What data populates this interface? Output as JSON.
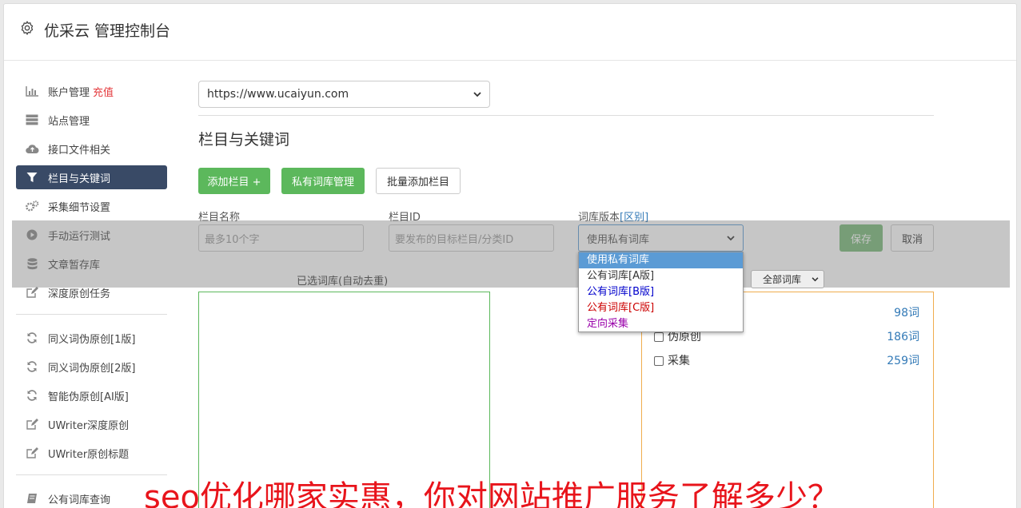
{
  "header": {
    "title": "优采云 管理控制台"
  },
  "sidebar": {
    "items": [
      {
        "label": "账户管理",
        "badge": "充值",
        "icon": "bar-chart-icon"
      },
      {
        "label": "站点管理",
        "icon": "server-icon"
      },
      {
        "label": "接口文件相关",
        "icon": "cloud-upload-icon"
      },
      {
        "label": "栏目与关键词",
        "icon": "filter-icon",
        "active": true
      },
      {
        "label": "采集细节设置",
        "icon": "gears-icon"
      },
      {
        "label": "手动运行测试",
        "icon": "play-circle-icon"
      },
      {
        "label": "文章暂存库",
        "icon": "database-icon"
      },
      {
        "label": "深度原创任务",
        "icon": "edit-icon"
      },
      {
        "label": "同义词伪原创[1版]",
        "icon": "refresh-icon"
      },
      {
        "label": "同义词伪原创[2版]",
        "icon": "refresh-icon"
      },
      {
        "label": "智能伪原创[AI版]",
        "icon": "refresh-icon"
      },
      {
        "label": "UWriter深度原创",
        "icon": "edit-icon"
      },
      {
        "label": "UWriter原创标题",
        "icon": "edit-icon"
      },
      {
        "label": "公有词库查询",
        "icon": "book-icon"
      }
    ]
  },
  "main": {
    "site_select": "https://www.ucaiyun.com",
    "section_title": "栏目与关键词",
    "buttons": {
      "add_column": "添加栏目 +",
      "private_lib": "私有词库管理",
      "batch_add": "批量添加栏目"
    },
    "form": {
      "column_name_label": "栏目名称",
      "column_name_placeholder": "最多10个字",
      "column_id_label": "栏目ID",
      "column_id_placeholder": "要发布的目标栏目/分类ID",
      "version_label": "词库版本",
      "version_link": "[区别]",
      "version_value": "使用私有词库",
      "save": "保存",
      "cancel": "取消"
    },
    "dropdown_options": [
      "使用私有词库",
      "公有词库[A版]",
      "公有词库[B版]",
      "公有词库[C版]",
      "定向采集"
    ],
    "selected_lib_label": "已选词库(自动去重)",
    "all_lib_select": "全部词库",
    "libraries": [
      {
        "name": "",
        "count": "98词"
      },
      {
        "name": "伪原创",
        "count": "186词"
      },
      {
        "name": "采集",
        "count": "259词"
      }
    ]
  },
  "watermark": "seo优化哪家实惠，你对网站推广服务了解多少？",
  "colors": {
    "accent_green": "#5cb85c",
    "active_nav": "#394a66",
    "badge_red": "#e4393c",
    "watermark": "#e8141b"
  }
}
